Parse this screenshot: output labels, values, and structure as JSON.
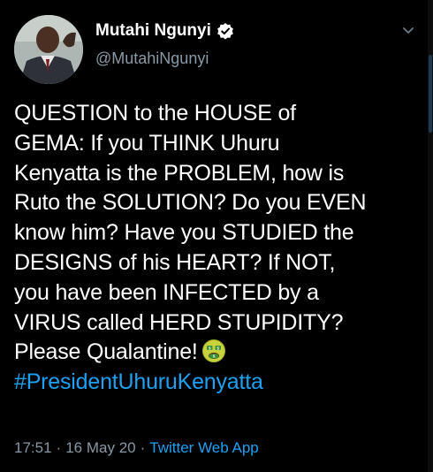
{
  "author": {
    "display_name": "Mutahi Ngunyi",
    "handle": "@MutahiNgunyi",
    "verified_icon": "verified-badge-icon",
    "avatar_icon": "avatar"
  },
  "tweet": {
    "lines": [
      "QUESTION to the HOUSE of",
      "GEMA: If you THINK Uhuru",
      "Kenyatta is the PROBLEM, how is",
      "Ruto the SOLUTION? Do you EVEN",
      "know him? Have you STUDIED the",
      "DESIGNS of his HEART? If NOT,",
      "you have been INFECTED by a",
      "VIRUS called HERD STUPIDITY?",
      "Please Qualantine!"
    ],
    "emoji": "nauseated-money-mouth-face",
    "hashtag": "#PresidentUhuruKenyatta"
  },
  "meta": {
    "time": "17:51",
    "separator": "·",
    "date": "16 May 20",
    "source": "Twitter Web App"
  },
  "colors": {
    "background": "#000000",
    "text": "#ffffff",
    "secondary": "#8899a6",
    "accent": "#1da1f2"
  }
}
